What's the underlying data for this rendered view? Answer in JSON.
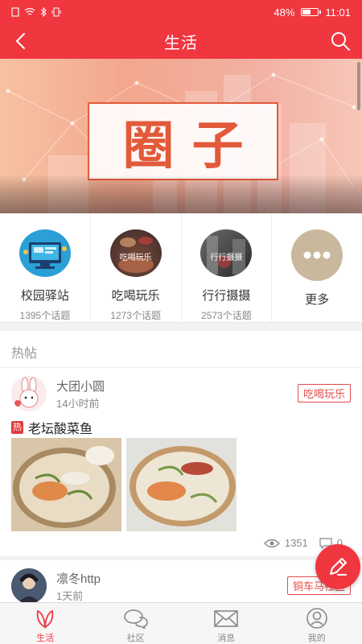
{
  "status": {
    "battery": "48%",
    "time": "11:01",
    "battery_level": 0.48
  },
  "header": {
    "title": "生活"
  },
  "banner": {
    "title": "圈子"
  },
  "categories": [
    {
      "name": "校园驿站",
      "count": "1395个话题",
      "overlay": ""
    },
    {
      "name": "吃喝玩乐",
      "count": "1273个话题",
      "overlay": "吃喝玩乐"
    },
    {
      "name": "行行摄摄",
      "count": "2573个话题",
      "overlay": "行行摄摄"
    },
    {
      "name": "更多",
      "count": "",
      "overlay": ""
    }
  ],
  "hot": {
    "title": "热帖"
  },
  "posts": [
    {
      "user": "大团小圆",
      "time": "14小时前",
      "tag": "吃喝玩乐",
      "badge": "热",
      "title": "老坛酸菜鱼",
      "views": "1351",
      "comments": "0"
    },
    {
      "user": "凛冬http",
      "time": "1天前",
      "tag": "铜车马社区"
    }
  ],
  "tabs": [
    {
      "label": "生活",
      "icon": "leaf-icon",
      "active": true
    },
    {
      "label": "社区",
      "icon": "chat-bubbles-icon",
      "active": false
    },
    {
      "label": "消息",
      "icon": "envelope-icon",
      "active": false
    },
    {
      "label": "我的",
      "icon": "user-icon",
      "active": false
    }
  ],
  "colors": {
    "brand": "#f0363f",
    "tag": "#e34b4b"
  }
}
